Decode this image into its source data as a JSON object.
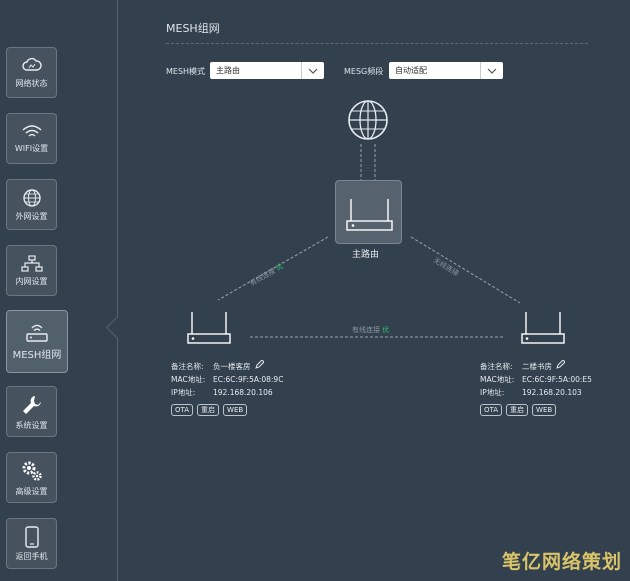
{
  "sidebar": {
    "items": [
      {
        "label": "网络状态",
        "icon": "cloud-icon"
      },
      {
        "label": "WIFI设置",
        "icon": "wifi-icon"
      },
      {
        "label": "外网设置",
        "icon": "globe-icon"
      },
      {
        "label": "内网设置",
        "icon": "lan-icon"
      },
      {
        "label": "MESH组网",
        "icon": "mesh-router-icon"
      },
      {
        "label": "系统设置",
        "icon": "wrench-icon"
      },
      {
        "label": "高级设置",
        "icon": "gears-icon"
      },
      {
        "label": "返回手机",
        "icon": "phone-icon"
      }
    ],
    "active_index": 4
  },
  "main": {
    "title": "MESH组网",
    "mesh_mode": {
      "label": "MESH模式",
      "value": "主路由"
    },
    "mesh_band": {
      "label": "MESG频段",
      "value": "自动适配"
    },
    "main_router_label": "主路由",
    "links": {
      "left_label": "有线连接",
      "left_status": "优",
      "right_label": "无线连接",
      "bottom_label": "有线连接",
      "bottom_status": "优"
    },
    "nodes": [
      {
        "name_label": "备注名称:",
        "name": "负一楼客房",
        "mac_label": "MAC地址:",
        "mac": "EC:6C:9F:5A:08:9C",
        "ip_label": "IP地址:",
        "ip": "192.168.20.106",
        "buttons": [
          "OTA",
          "重启",
          "WEB"
        ]
      },
      {
        "name_label": "备注名称:",
        "name": "二楼书房",
        "mac_label": "MAC地址:",
        "mac": "EC:6C:9F:5A:00:E5",
        "ip_label": "IP地址:",
        "ip": "192.168.20.103",
        "buttons": [
          "OTA",
          "重启",
          "WEB"
        ]
      }
    ]
  },
  "watermark": "笔亿网络策划",
  "colors": {
    "background": "#33404d",
    "sidebar_item": "#46535f",
    "status_ok": "#2fbf71"
  }
}
